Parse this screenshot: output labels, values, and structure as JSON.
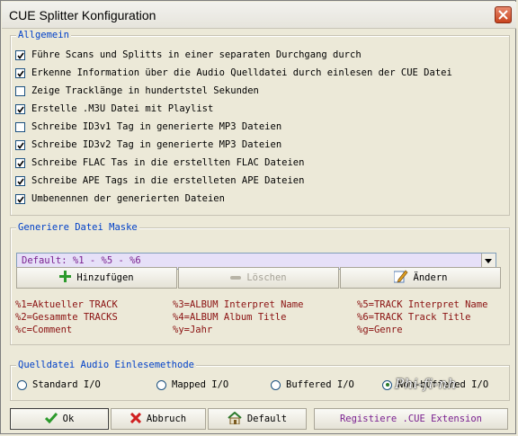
{
  "window": {
    "title": "CUE Splitter Konfiguration"
  },
  "general": {
    "legend": "Allgemein",
    "options": [
      {
        "label": "Führe Scans und Splitts in einer separaten Durchgang durch",
        "checked": true
      },
      {
        "label": "Erkenne Information über die Audio Quelldatei durch einlesen der CUE Datei",
        "checked": true
      },
      {
        "label": "Zeige Tracklänge in hundertstel Sekunden",
        "checked": false
      },
      {
        "label": "Erstelle .M3U Datei mit Playlist",
        "checked": true
      },
      {
        "label": "Schreibe ID3v1 Tag in generierte MP3 Dateien",
        "checked": false
      },
      {
        "label": "Schreibe ID3v2 Tag in generierte MP3 Dateien",
        "checked": true
      },
      {
        "label": "Schreibe FLAC Tas in die erstellten FLAC Dateien",
        "checked": true
      },
      {
        "label": "Schreibe APE Tags in die erstelleten APE Dateien",
        "checked": true
      },
      {
        "label": "Umbenennen der generierten Dateien",
        "checked": true
      }
    ]
  },
  "mask": {
    "legend": "Generiere Datei Maske",
    "selected": "Default: %1 - %5 - %6",
    "add_label": "Hinzufügen",
    "delete_label": "Löschen",
    "edit_label": "Ändern",
    "codes": [
      [
        "%1=Aktueller TRACK",
        "%3=ALBUM Interpret Name",
        "%5=TRACK Interpret Name"
      ],
      [
        "%2=Gesammte TRACKS",
        "%4=ALBUM Album Title",
        "%6=TRACK Track Title"
      ],
      [
        "%c=Comment",
        "%y=Jahr",
        "%g=Genre"
      ]
    ]
  },
  "read_method": {
    "legend": "Quelldatei Audio Einlesemethode",
    "options": [
      {
        "label": "Standard I/O",
        "selected": false
      },
      {
        "label": "Mapped I/O",
        "selected": false
      },
      {
        "label": "Buffered I/O",
        "selected": false
      },
      {
        "label": "Non-buffered I/O",
        "selected": true
      }
    ]
  },
  "footer": {
    "ok_label": "Ok",
    "cancel_label": "Abbruch",
    "default_label": "Default",
    "register_label": "Registiere .CUE Extension"
  },
  "watermark": "Phi-fi-nh",
  "icons": {
    "close": "close-icon",
    "add": "plus-icon",
    "delete": "minus-icon",
    "edit": "pencil-icon",
    "ok": "checkmark-icon",
    "cancel": "x-icon",
    "default": "home-icon"
  }
}
